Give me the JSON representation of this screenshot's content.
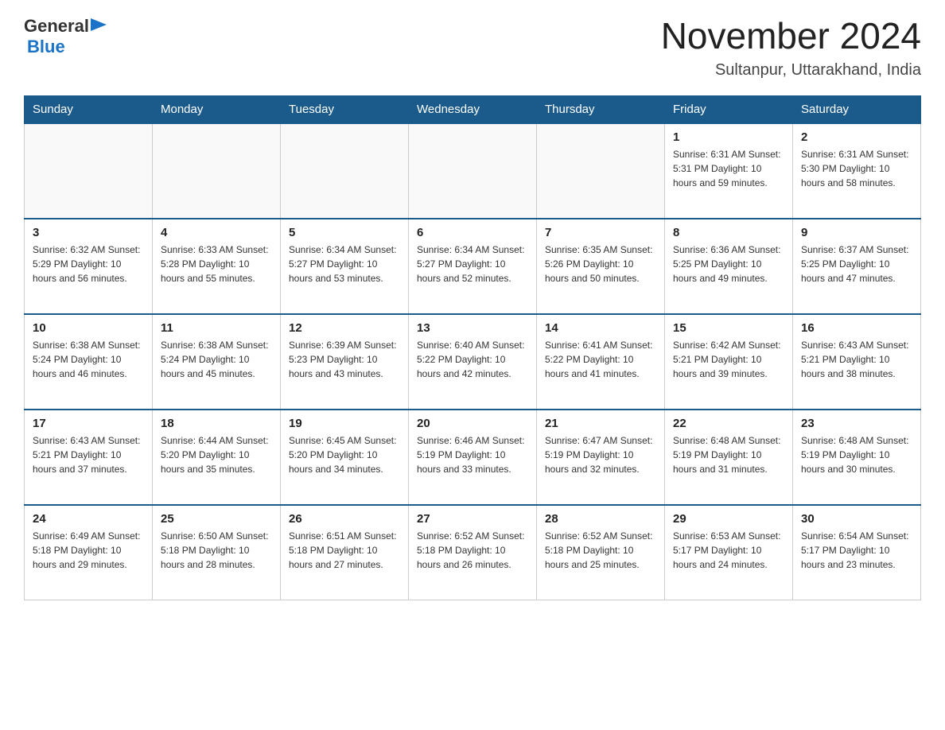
{
  "header": {
    "logo_general": "General",
    "logo_blue": "Blue",
    "title": "November 2024",
    "subtitle": "Sultanpur, Uttarakhand, India"
  },
  "days_of_week": [
    "Sunday",
    "Monday",
    "Tuesday",
    "Wednesday",
    "Thursday",
    "Friday",
    "Saturday"
  ],
  "weeks": [
    [
      {
        "day": "",
        "detail": ""
      },
      {
        "day": "",
        "detail": ""
      },
      {
        "day": "",
        "detail": ""
      },
      {
        "day": "",
        "detail": ""
      },
      {
        "day": "",
        "detail": ""
      },
      {
        "day": "1",
        "detail": "Sunrise: 6:31 AM\nSunset: 5:31 PM\nDaylight: 10 hours\nand 59 minutes."
      },
      {
        "day": "2",
        "detail": "Sunrise: 6:31 AM\nSunset: 5:30 PM\nDaylight: 10 hours\nand 58 minutes."
      }
    ],
    [
      {
        "day": "3",
        "detail": "Sunrise: 6:32 AM\nSunset: 5:29 PM\nDaylight: 10 hours\nand 56 minutes."
      },
      {
        "day": "4",
        "detail": "Sunrise: 6:33 AM\nSunset: 5:28 PM\nDaylight: 10 hours\nand 55 minutes."
      },
      {
        "day": "5",
        "detail": "Sunrise: 6:34 AM\nSunset: 5:27 PM\nDaylight: 10 hours\nand 53 minutes."
      },
      {
        "day": "6",
        "detail": "Sunrise: 6:34 AM\nSunset: 5:27 PM\nDaylight: 10 hours\nand 52 minutes."
      },
      {
        "day": "7",
        "detail": "Sunrise: 6:35 AM\nSunset: 5:26 PM\nDaylight: 10 hours\nand 50 minutes."
      },
      {
        "day": "8",
        "detail": "Sunrise: 6:36 AM\nSunset: 5:25 PM\nDaylight: 10 hours\nand 49 minutes."
      },
      {
        "day": "9",
        "detail": "Sunrise: 6:37 AM\nSunset: 5:25 PM\nDaylight: 10 hours\nand 47 minutes."
      }
    ],
    [
      {
        "day": "10",
        "detail": "Sunrise: 6:38 AM\nSunset: 5:24 PM\nDaylight: 10 hours\nand 46 minutes."
      },
      {
        "day": "11",
        "detail": "Sunrise: 6:38 AM\nSunset: 5:24 PM\nDaylight: 10 hours\nand 45 minutes."
      },
      {
        "day": "12",
        "detail": "Sunrise: 6:39 AM\nSunset: 5:23 PM\nDaylight: 10 hours\nand 43 minutes."
      },
      {
        "day": "13",
        "detail": "Sunrise: 6:40 AM\nSunset: 5:22 PM\nDaylight: 10 hours\nand 42 minutes."
      },
      {
        "day": "14",
        "detail": "Sunrise: 6:41 AM\nSunset: 5:22 PM\nDaylight: 10 hours\nand 41 minutes."
      },
      {
        "day": "15",
        "detail": "Sunrise: 6:42 AM\nSunset: 5:21 PM\nDaylight: 10 hours\nand 39 minutes."
      },
      {
        "day": "16",
        "detail": "Sunrise: 6:43 AM\nSunset: 5:21 PM\nDaylight: 10 hours\nand 38 minutes."
      }
    ],
    [
      {
        "day": "17",
        "detail": "Sunrise: 6:43 AM\nSunset: 5:21 PM\nDaylight: 10 hours\nand 37 minutes."
      },
      {
        "day": "18",
        "detail": "Sunrise: 6:44 AM\nSunset: 5:20 PM\nDaylight: 10 hours\nand 35 minutes."
      },
      {
        "day": "19",
        "detail": "Sunrise: 6:45 AM\nSunset: 5:20 PM\nDaylight: 10 hours\nand 34 minutes."
      },
      {
        "day": "20",
        "detail": "Sunrise: 6:46 AM\nSunset: 5:19 PM\nDaylight: 10 hours\nand 33 minutes."
      },
      {
        "day": "21",
        "detail": "Sunrise: 6:47 AM\nSunset: 5:19 PM\nDaylight: 10 hours\nand 32 minutes."
      },
      {
        "day": "22",
        "detail": "Sunrise: 6:48 AM\nSunset: 5:19 PM\nDaylight: 10 hours\nand 31 minutes."
      },
      {
        "day": "23",
        "detail": "Sunrise: 6:48 AM\nSunset: 5:19 PM\nDaylight: 10 hours\nand 30 minutes."
      }
    ],
    [
      {
        "day": "24",
        "detail": "Sunrise: 6:49 AM\nSunset: 5:18 PM\nDaylight: 10 hours\nand 29 minutes."
      },
      {
        "day": "25",
        "detail": "Sunrise: 6:50 AM\nSunset: 5:18 PM\nDaylight: 10 hours\nand 28 minutes."
      },
      {
        "day": "26",
        "detail": "Sunrise: 6:51 AM\nSunset: 5:18 PM\nDaylight: 10 hours\nand 27 minutes."
      },
      {
        "day": "27",
        "detail": "Sunrise: 6:52 AM\nSunset: 5:18 PM\nDaylight: 10 hours\nand 26 minutes."
      },
      {
        "day": "28",
        "detail": "Sunrise: 6:52 AM\nSunset: 5:18 PM\nDaylight: 10 hours\nand 25 minutes."
      },
      {
        "day": "29",
        "detail": "Sunrise: 6:53 AM\nSunset: 5:17 PM\nDaylight: 10 hours\nand 24 minutes."
      },
      {
        "day": "30",
        "detail": "Sunrise: 6:54 AM\nSunset: 5:17 PM\nDaylight: 10 hours\nand 23 minutes."
      }
    ]
  ]
}
